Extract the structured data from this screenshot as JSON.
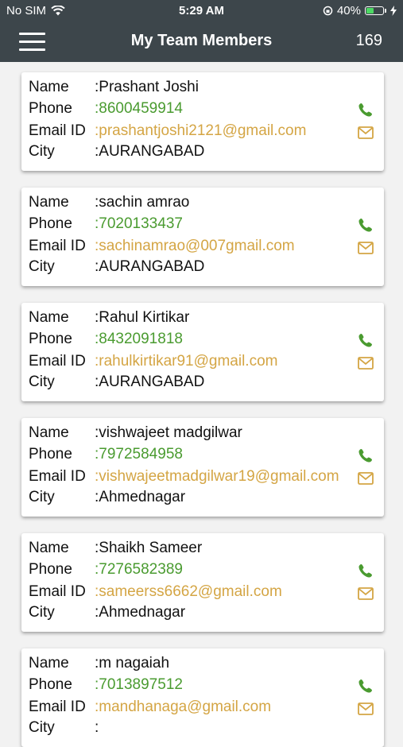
{
  "status_bar": {
    "carrier": "No SIM",
    "time": "5:29 AM",
    "battery": "40%",
    "battery_level": 0.4
  },
  "header": {
    "title": "My Team Members",
    "count": "169"
  },
  "labels": {
    "name": "Name",
    "phone": "Phone",
    "email": "Email ID",
    "city": "City",
    "sep": ":"
  },
  "colors": {
    "header_bg": "#3d464b",
    "phone_green": "#4a9b30",
    "email_gold": "#d4a544"
  },
  "icons": {
    "menu": "hamburger-menu-icon",
    "phone": "phone-icon",
    "email": "mail-icon",
    "wifi": "wifi-icon"
  },
  "members": [
    {
      "name": "Prashant Joshi",
      "phone": "8600459914",
      "email": "prashantjoshi2121@gmail.com",
      "city": "AURANGABAD"
    },
    {
      "name": "sachin amrao",
      "phone": "7020133437",
      "email": "sachinamrao@007gmail.com",
      "city": "AURANGABAD"
    },
    {
      "name": "Rahul Kirtikar",
      "phone": "8432091818",
      "email": "rahulkirtikar91@gmail.com",
      "city": "AURANGABAD"
    },
    {
      "name": "vishwajeet madgilwar",
      "phone": "7972584958",
      "email": "vishwajeetmadgilwar19@gmail.com",
      "city": "Ahmednagar"
    },
    {
      "name": "Shaikh Sameer",
      "phone": "7276582389",
      "email": "sameerss6662@gmail.com",
      "city": "Ahmednagar"
    },
    {
      "name": "m nagaiah",
      "phone": "7013897512",
      "email": "mandhanaga@gmail.com",
      "city": ""
    }
  ]
}
